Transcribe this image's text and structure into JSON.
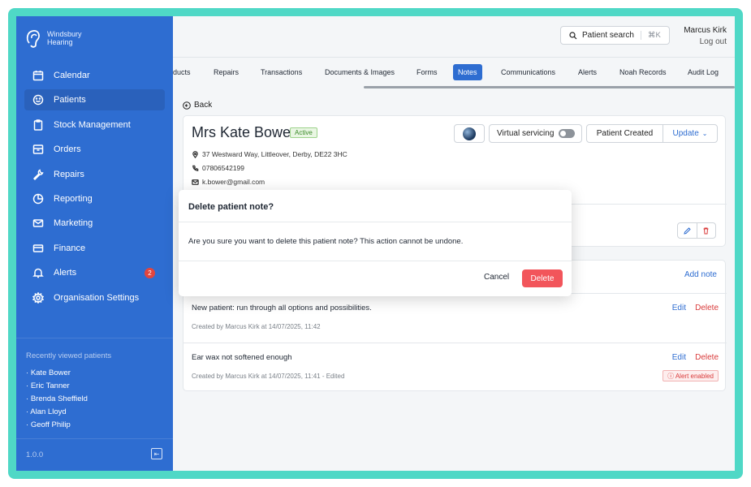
{
  "brand": {
    "line1": "Windsbury",
    "line2": "Hearing"
  },
  "sidebar": {
    "items": [
      {
        "label": "Calendar",
        "icon": "calendar-icon"
      },
      {
        "label": "Patients",
        "icon": "smile-icon"
      },
      {
        "label": "Stock Management",
        "icon": "clipboard-icon"
      },
      {
        "label": "Orders",
        "icon": "box-icon"
      },
      {
        "label": "Repairs",
        "icon": "wrench-icon"
      },
      {
        "label": "Reporting",
        "icon": "pie-chart-icon"
      },
      {
        "label": "Marketing",
        "icon": "mail-icon"
      },
      {
        "label": "Finance",
        "icon": "card-icon"
      },
      {
        "label": "Alerts",
        "icon": "bell-icon",
        "badge": "2"
      },
      {
        "label": "Organisation Settings",
        "icon": "gear-icon"
      }
    ],
    "recent_title": "Recently viewed patients",
    "recent": [
      "Kate Bower",
      "Eric Tanner",
      "Brenda Sheffield",
      "Alan Lloyd",
      "Geoff Philip"
    ],
    "version": "1.0.0"
  },
  "header": {
    "search_label": "Patient search",
    "search_shortcut": "⌘K",
    "user_name": "Marcus Kirk",
    "logout": "Log out"
  },
  "tabs": [
    "ducts",
    "Repairs",
    "Transactions",
    "Documents & Images",
    "Forms",
    "Notes",
    "Communications",
    "Alerts",
    "Noah Records",
    "Audit Log"
  ],
  "active_tab": "Notes",
  "back_label": "Back",
  "patient": {
    "name": "Mrs Kate Bower",
    "status": "Active",
    "address": "37 Westward Way, Littleover, Derby, DE22 3HC",
    "phone": "07806542199",
    "email": "k.bower@gmail.com",
    "virtual_servicing_label": "Virtual servicing",
    "status_button": "Patient Created",
    "update_button": "Update"
  },
  "notes": {
    "add_note": "Add note",
    "items": [
      {
        "text": "New patient: run through all options and possibilities.",
        "meta": "Created by Marcus Kirk at 14/07/2025, 11:42",
        "edit": "Edit",
        "delete": "Delete"
      },
      {
        "text": "Ear wax not softened enough",
        "meta": "Created by Marcus Kirk at 14/07/2025, 11:41 - Edited",
        "edit": "Edit",
        "delete": "Delete",
        "alert": "Alert enabled"
      }
    ]
  },
  "modal": {
    "title": "Delete patient note?",
    "body": "Are you sure you want to delete this patient note? This action cannot be undone.",
    "cancel": "Cancel",
    "confirm": "Delete"
  },
  "colors": {
    "accent": "#2e6dd1",
    "danger": "#f2555b",
    "frame": "#4fd8c6"
  }
}
